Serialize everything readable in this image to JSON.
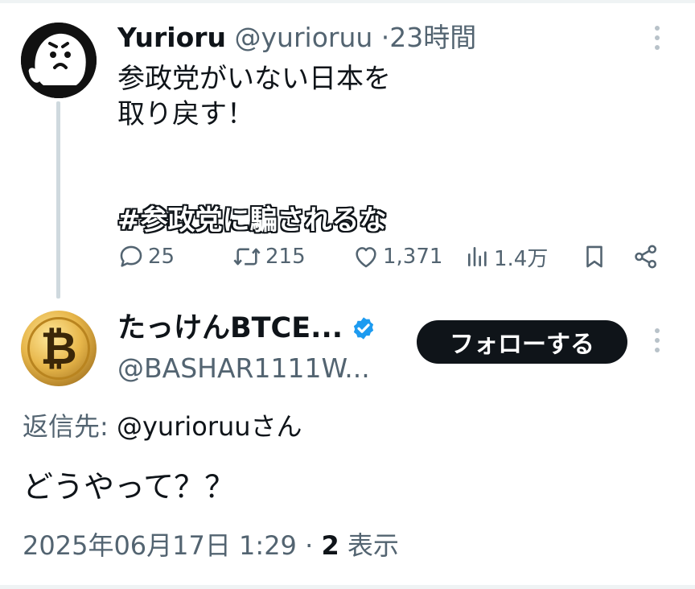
{
  "parent_tweet": {
    "author_name": "Yurioru",
    "handle": "@yurioruu",
    "separator": "·",
    "time": "23時間",
    "lines": [
      "参政党がいない日本を",
      "取り戻す！"
    ],
    "hashtag": "#参政党に騙されるな",
    "stats": {
      "replies": "25",
      "retweets": "215",
      "likes": "1,371",
      "views": "1.4万"
    },
    "icons": [
      "reply-icon",
      "retweet-icon",
      "like-icon",
      "views-icon",
      "bookmark-icon",
      "share-icon",
      "more-icon"
    ]
  },
  "reply_tweet": {
    "author_name": "たっけんBTCE...",
    "verified": true,
    "handle": "@BASHAR1111W...",
    "follow_label": "フォローする",
    "replying_label": "返信先: ",
    "replying_to": "@yurioruuさん",
    "text": "どうやって？？",
    "date": "2025年06月17日 1:29 · ",
    "view_count": "2",
    "view_label": " 表示",
    "avatar_glyph": "₿"
  },
  "colors": {
    "text_primary": "#0f1419",
    "text_secondary": "#536471",
    "verified_blue": "#1d9bf0",
    "thread_line": "#cfd9de",
    "follow_button_bg": "#0f1419"
  }
}
